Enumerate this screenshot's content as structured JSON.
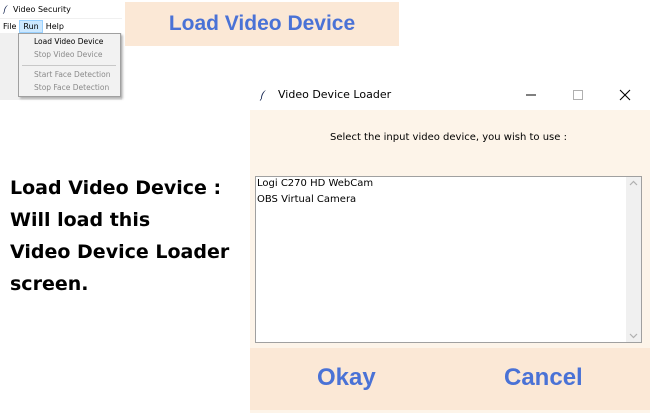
{
  "app_window": {
    "title": "Video Security",
    "menubar": [
      "File",
      "Run",
      "Help"
    ],
    "run_menu": {
      "items": [
        {
          "label": "Load Video Device",
          "enabled": true
        },
        {
          "label": "Stop Video Device",
          "enabled": false
        },
        {
          "label": "Start Face Detection",
          "enabled": false
        },
        {
          "label": "Stop Face Detection",
          "enabled": false
        }
      ]
    }
  },
  "banner": {
    "text": "Load Video Device"
  },
  "annotation": {
    "lines": [
      "Load Video Device :",
      "Will load this",
      "Video Device Loader",
      "screen."
    ]
  },
  "loader": {
    "title": "Video Device Loader",
    "prompt": "Select the input video device, you wish to use :",
    "devices": [
      "Logi C270 HD WebCam",
      "OBS Virtual Camera"
    ],
    "okay_label": "Okay",
    "cancel_label": "Cancel"
  },
  "colors": {
    "accent_text": "#4a72d6",
    "banner_bg": "#fbe8d6",
    "dialog_bg": "#fdf4e9",
    "menu_highlight": "#cce8ff"
  },
  "icons": {
    "app": "feather-icon",
    "minimize": "minimize-icon",
    "maximize": "maximize-icon",
    "close": "close-icon"
  }
}
